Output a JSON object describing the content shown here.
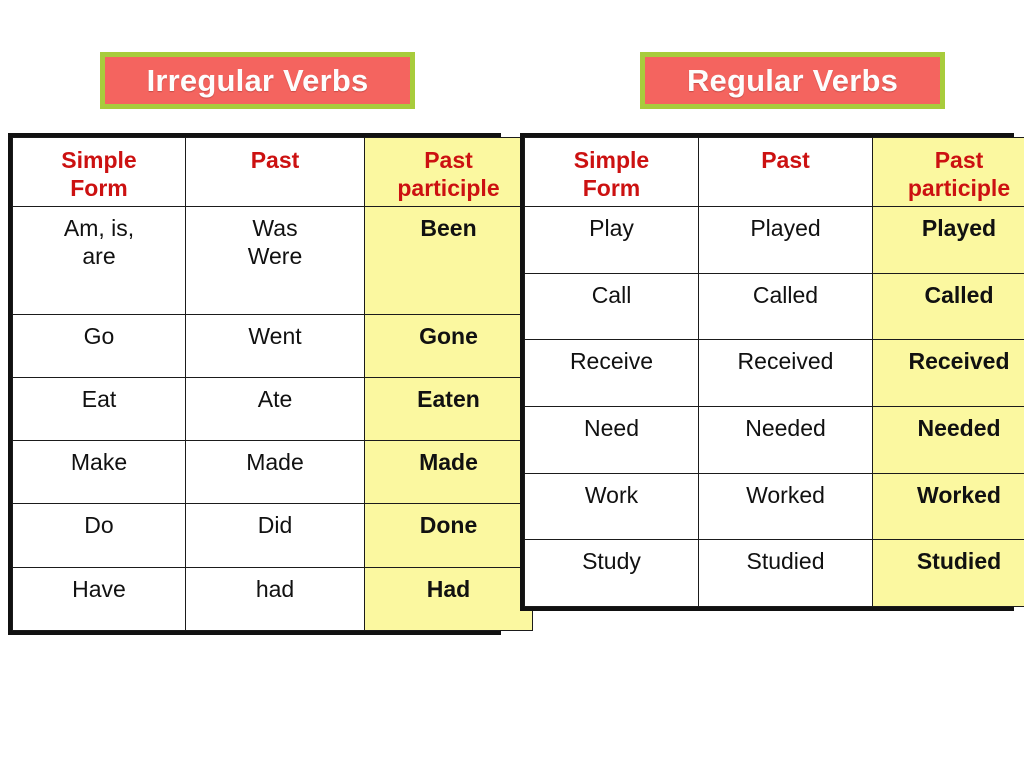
{
  "page": {
    "background_color": "#ffffff"
  },
  "banners": {
    "irregular": {
      "label": "Irregular Verbs",
      "fill_color": "#f4645f",
      "border_color": "#a8cc3c",
      "text_color": "#ffffff"
    },
    "regular": {
      "label": "Regular Verbs",
      "fill_color": "#f4645f",
      "border_color": "#a8cc3c",
      "text_color": "#ffffff"
    }
  },
  "styles": {
    "header_text_color": "#cc1111",
    "highlight_column_color": "#fbf8a0",
    "table_border_color": "#111111",
    "body_text_color": "#111111"
  },
  "irregular_table": {
    "title": "Irregular Verbs",
    "headers": [
      "Simple\nForm",
      "Past",
      "Past\nparticiple"
    ],
    "rows": [
      {
        "simple": "Am, is,\nare",
        "past": "Was\nWere",
        "participle": "Been"
      },
      {
        "simple": "Go",
        "past": "Went",
        "participle": "Gone"
      },
      {
        "simple": "Eat",
        "past": "Ate",
        "participle": "Eaten"
      },
      {
        "simple": "Make",
        "past": "Made",
        "participle": "Made"
      },
      {
        "simple": "Do",
        "past": "Did",
        "participle": "Done"
      },
      {
        "simple": "Have",
        "past": "had",
        "participle": "Had"
      }
    ]
  },
  "regular_table": {
    "title": "Regular Verbs",
    "headers": [
      "Simple\nForm",
      "Past",
      "Past\nparticiple"
    ],
    "rows": [
      {
        "simple": "Play",
        "past": "Played",
        "participle": "Played"
      },
      {
        "simple": "Call",
        "past": "Called",
        "participle": "Called"
      },
      {
        "simple": "Receive",
        "past": "Received",
        "participle": "Received"
      },
      {
        "simple": "Need",
        "past": "Needed",
        "participle": "Needed"
      },
      {
        "simple": "Work",
        "past": "Worked",
        "participle": "Worked"
      },
      {
        "simple": "Study",
        "past": "Studied",
        "participle": "Studied"
      }
    ]
  }
}
